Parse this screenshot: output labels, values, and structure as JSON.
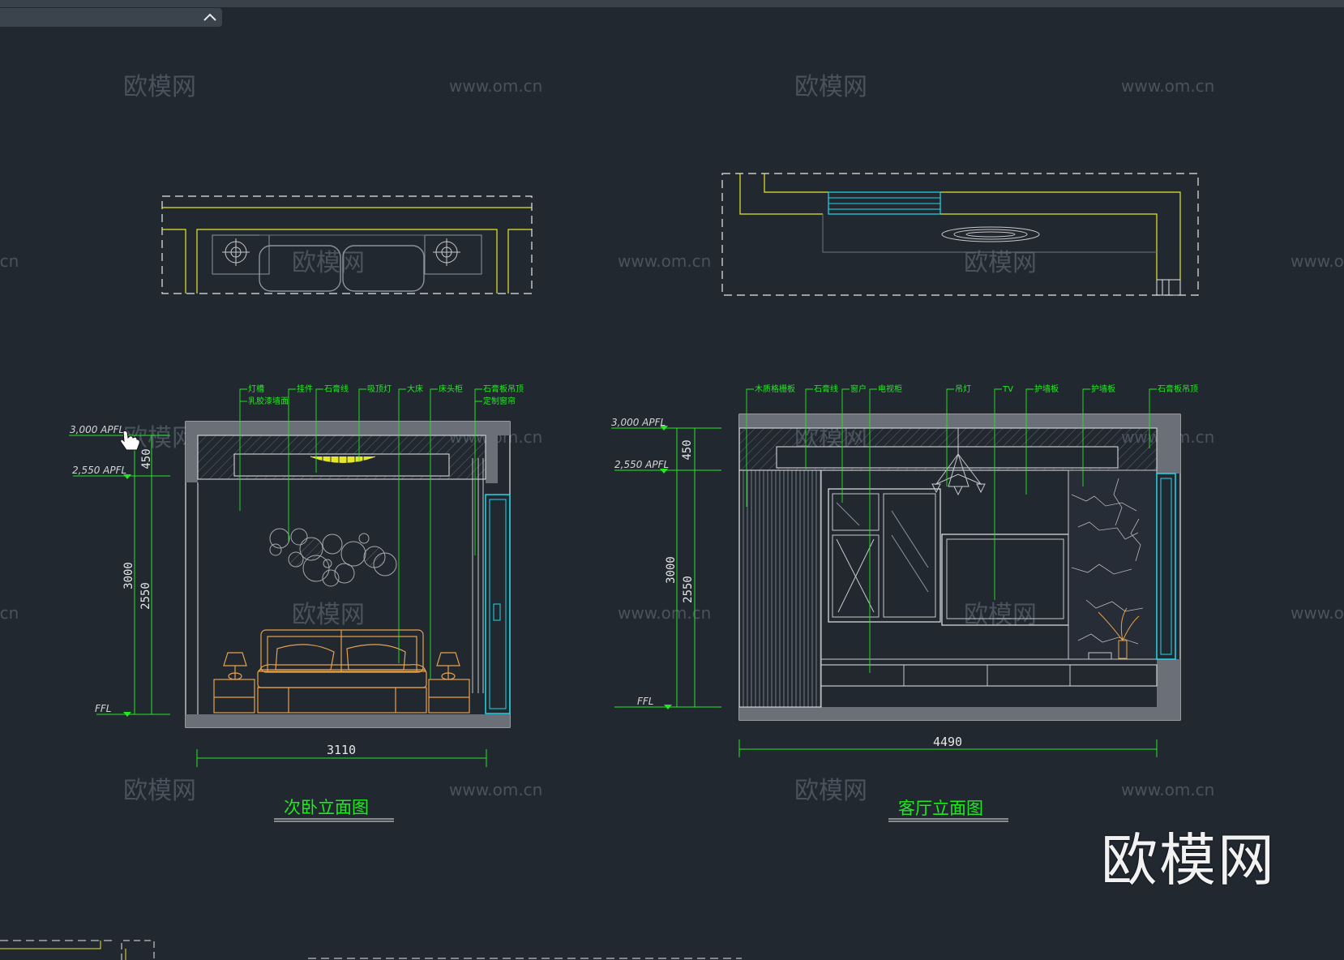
{
  "watermark": {
    "cn": "欧模网",
    "url": "www.om.cn"
  },
  "brand_watermark": "欧模网",
  "colors": {
    "background": "#212830",
    "ceiling_yellow": "#e6e62a",
    "label_green": "#22e822",
    "glass_cyan": "#22d8e8",
    "furniture_orange": "#e8a24a",
    "wall_grey": "#a0a0a0"
  },
  "bedroom": {
    "title": "次卧立面图",
    "width_dim": "3110",
    "level_top": "3,000 APFL",
    "level_ceiling": "2,550 APFL",
    "level_floor": "FFL",
    "dims": {
      "top": "450",
      "total": "3000",
      "wall": "2550"
    },
    "callouts_row1": [
      "灯槽",
      "挂件",
      "石膏线",
      "吸顶灯",
      "大床",
      "床头柜",
      "石膏板吊顶"
    ],
    "callouts_row2": [
      "乳胶漆墙面",
      "定制窗帘"
    ]
  },
  "living": {
    "title": "客厅立面图",
    "width_dim": "4490",
    "level_top": "3,000 APFL",
    "level_ceiling": "2,550 APFL",
    "level_floor": "FFL",
    "dims": {
      "top": "450",
      "total": "3000",
      "wall": "2550"
    },
    "callouts": [
      "木质格栅板",
      "石膏线",
      "窗户",
      "电视柜",
      "吊灯",
      "TV",
      "护墙板",
      "护墙板",
      "石膏板吊顶"
    ]
  }
}
